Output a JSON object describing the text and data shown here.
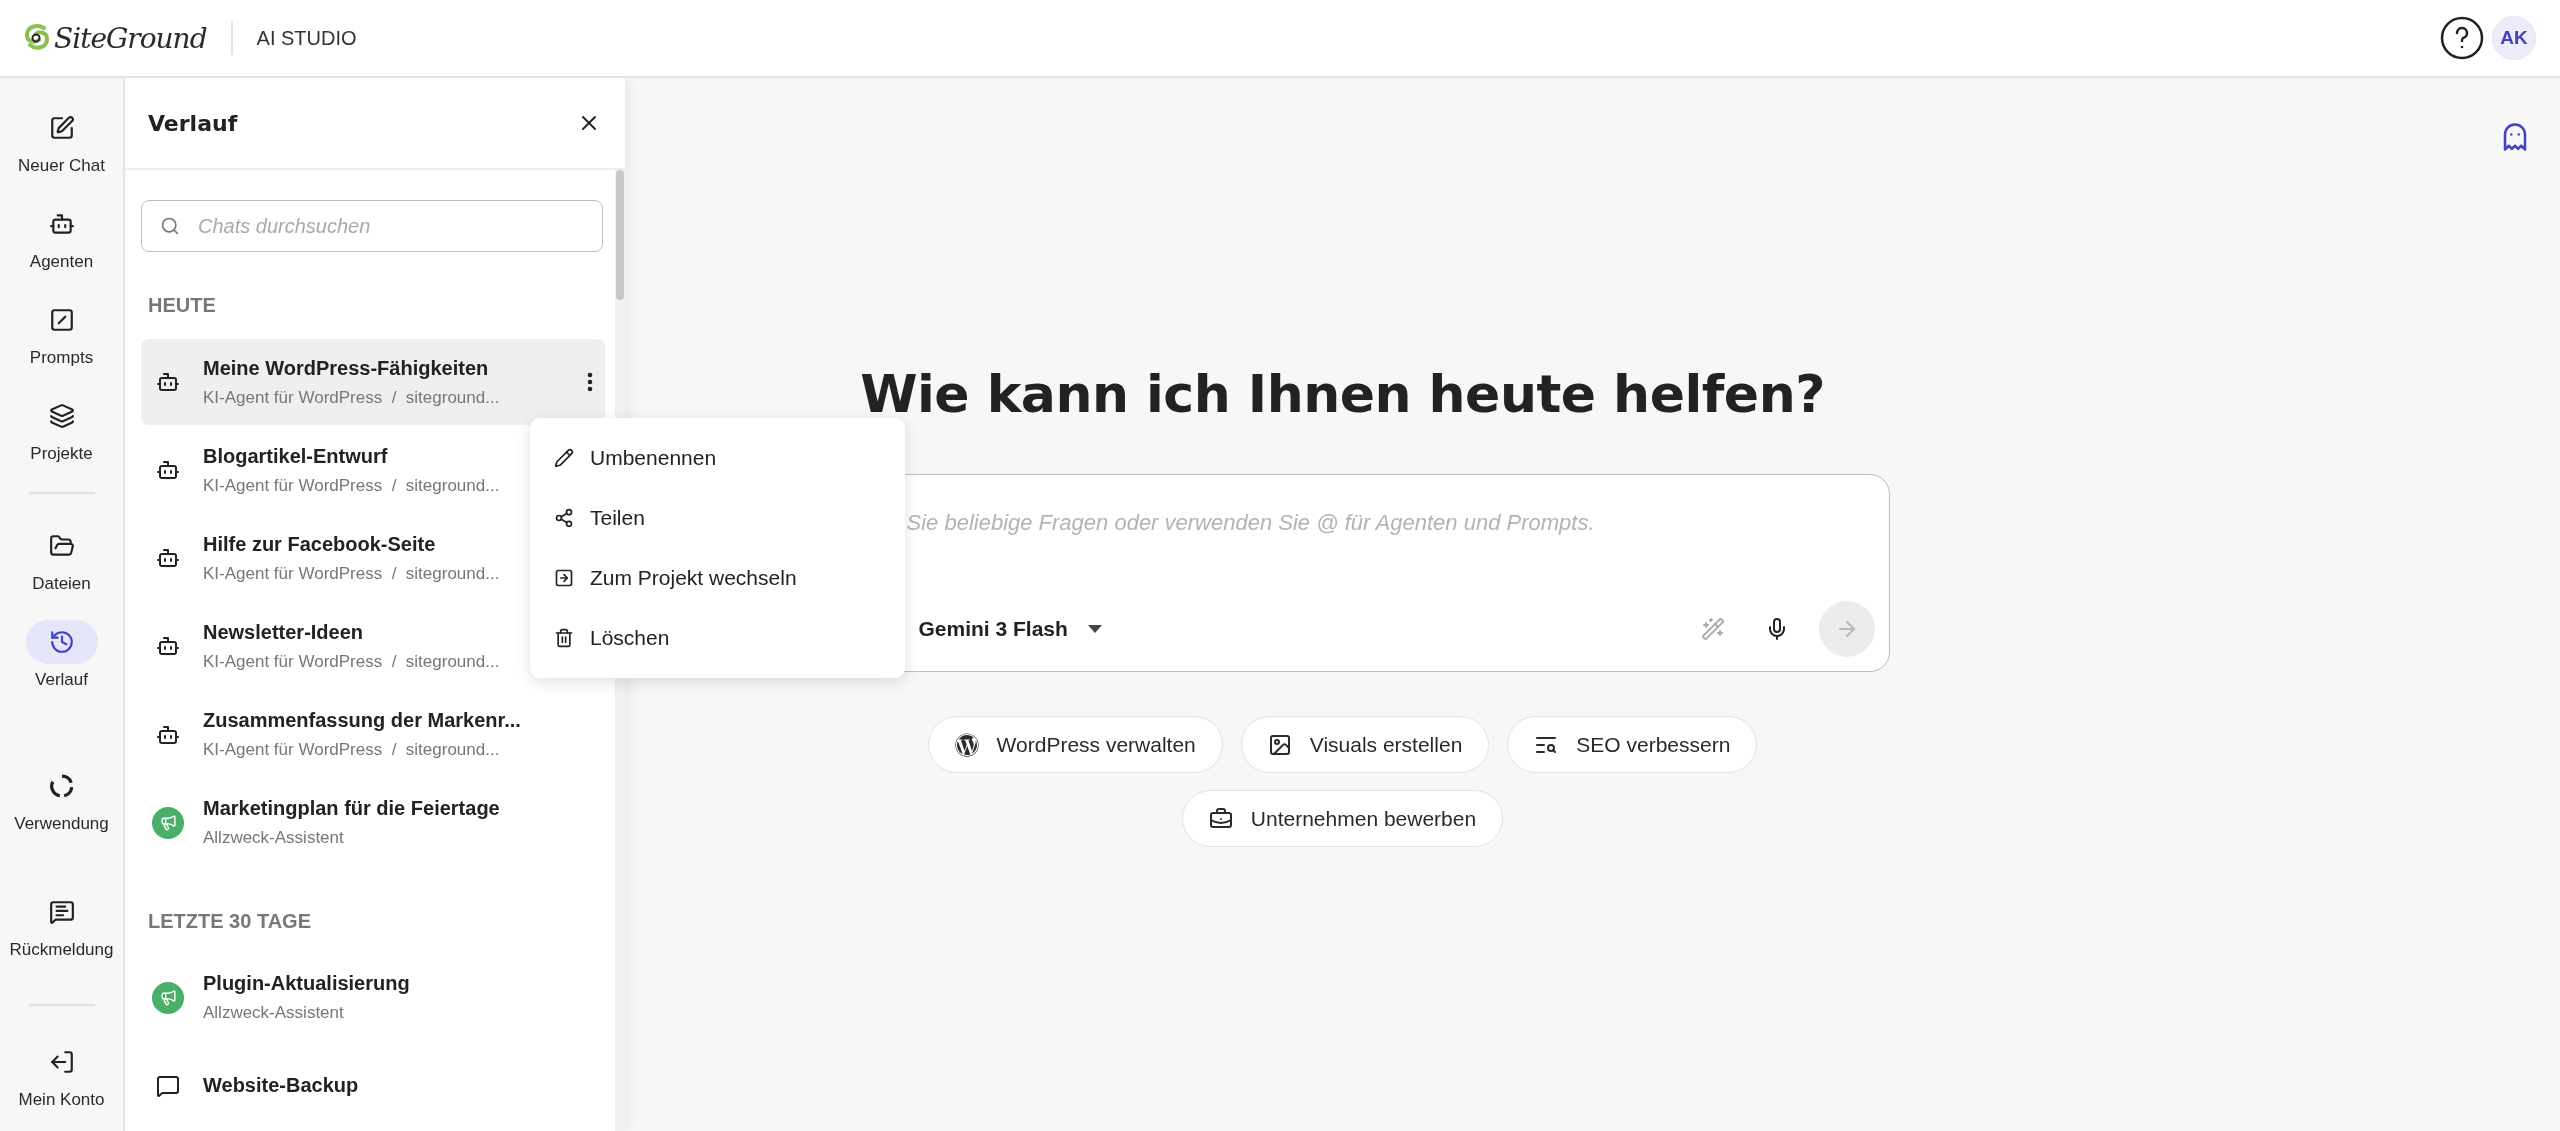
{
  "header": {
    "logo": "SiteGround",
    "product": "AI STUDIO",
    "avatar": "AK"
  },
  "rail": {
    "primary": [
      {
        "label": "Neuer Chat",
        "kind": "new-chat",
        "selected": false
      },
      {
        "label": "Agenten",
        "kind": "agents",
        "selected": false
      },
      {
        "label": "Prompts",
        "kind": "prompts",
        "selected": false
      },
      {
        "label": "Projekte",
        "kind": "projects",
        "selected": false
      }
    ],
    "library": [
      {
        "label": "Dateien",
        "kind": "files",
        "selected": false
      },
      {
        "label": "Verlauf",
        "kind": "history",
        "selected": true
      }
    ],
    "utility": [
      {
        "label": "Verwendung",
        "kind": "usage",
        "selected": false
      },
      {
        "label": "Rückmeldung",
        "kind": "feedback",
        "selected": false
      }
    ],
    "account": [
      {
        "label": "Mein Konto",
        "kind": "account",
        "selected": false
      }
    ]
  },
  "history": {
    "title": "Verlauf",
    "search": {
      "placeholder": "Chats durchsuchen"
    },
    "groups": [
      {
        "heading": "HEUTE",
        "items": [
          {
            "title": "Meine WordPress-Fähigkeiten",
            "subtitle": "KI-Agent für WordPress  /  siteground...",
            "kind": "agent",
            "selected": true
          },
          {
            "title": "Blogartikel-Entwurf",
            "subtitle": "KI-Agent für WordPress  /  siteground...",
            "kind": "agent",
            "selected": false
          },
          {
            "title": "Hilfe zur Facebook-Seite",
            "subtitle": "KI-Agent für WordPress  /  siteground...",
            "kind": "agent",
            "selected": false
          },
          {
            "title": "Newsletter-Ideen",
            "subtitle": "KI-Agent für WordPress  /  siteground...",
            "kind": "agent",
            "selected": false
          },
          {
            "title": "Zusammenfassung der Markenr...",
            "subtitle": "KI-Agent für WordPress  /  siteground...",
            "kind": "agent",
            "selected": false
          },
          {
            "title": "Marketingplan für die Feiertage",
            "subtitle": "Allzweck-Assistent",
            "kind": "assistant",
            "selected": false
          }
        ]
      },
      {
        "heading": "LETZTE 30 TAGE",
        "items": [
          {
            "title": "Plugin-Aktualisierung",
            "subtitle": "Allzweck-Assistent",
            "kind": "assistant",
            "selected": false
          },
          {
            "title": "Website-Backup",
            "kind": "chat",
            "selected": false
          }
        ]
      }
    ]
  },
  "context_menu": {
    "items": [
      {
        "label": "Umbenennen",
        "kind": "rename"
      },
      {
        "label": "Teilen",
        "kind": "share"
      },
      {
        "label": "Zum Projekt wechseln",
        "kind": "move"
      },
      {
        "label": "Löschen",
        "kind": "delete"
      }
    ]
  },
  "main": {
    "headline": "Wie kann ich Ihnen heute helfen?",
    "composer": {
      "placeholder": "Sie beliebige Fragen oder verwenden Sie @ für Agenten und Prompts.",
      "model": "Gemini 3 Flash"
    },
    "suggestions": [
      {
        "label": "WordPress verwalten",
        "kind": "wordpress"
      },
      {
        "label": "Visuals erstellen",
        "kind": "image"
      },
      {
        "label": "SEO verbessern",
        "kind": "seo"
      },
      {
        "label": "Unternehmen bewerben",
        "kind": "business"
      }
    ]
  }
}
